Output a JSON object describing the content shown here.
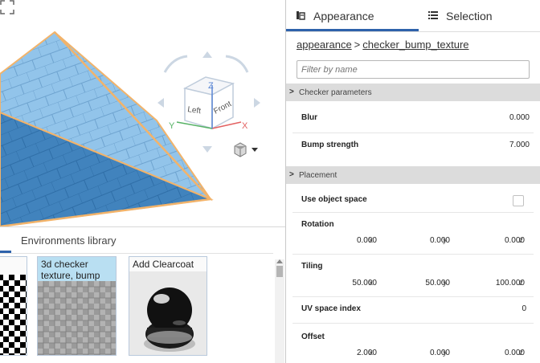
{
  "tabs": [
    {
      "label": "Appearance",
      "icon": "appearance-icon",
      "active": true
    },
    {
      "label": "Selection",
      "icon": "list-icon",
      "active": false
    }
  ],
  "breadcrumb": {
    "root": "appearance",
    "separator": ">",
    "current": "checker_bump_texture"
  },
  "filter": {
    "placeholder": "Filter by name"
  },
  "sections": {
    "checker": "Checker parameters",
    "placement": "Placement"
  },
  "checker": {
    "blur_label": "Blur",
    "blur_value": "0.000",
    "bump_label": "Bump strength",
    "bump_value": "7.000"
  },
  "placement": {
    "object_space_label": "Use object space",
    "object_space_checked": false,
    "rotation_label": "Rotation",
    "rotation": {
      "x": "0.000",
      "y": "0.000",
      "z": "0.000"
    },
    "tiling_label": "Tiling",
    "tiling": {
      "x": "50.000",
      "y": "50.000",
      "z": "100.000"
    },
    "uv_label": "UV space index",
    "uv_value": "0",
    "offset_label": "Offset",
    "offset": {
      "x": "2.000",
      "y": "0.000",
      "z": "0.000"
    },
    "axes": {
      "x": "x",
      "y": "y",
      "z": "z"
    }
  },
  "library": {
    "tab_label": "Environments library",
    "items": [
      {
        "label": "",
        "selected": false
      },
      {
        "label": "3d checker texture, bump",
        "selected": true
      },
      {
        "label": "Add Clearcoat",
        "selected": false
      }
    ]
  },
  "viewcube": {
    "left": "Left",
    "front": "Front",
    "axis_x": "X",
    "axis_y": "Y",
    "axis_z": "Z"
  },
  "colors": {
    "accent": "#2e62ab",
    "model": "#8ec1e8",
    "model_dark": "#3f7fb5",
    "edge": "#f2b36a",
    "selected_thumb": "#b9dff2"
  }
}
